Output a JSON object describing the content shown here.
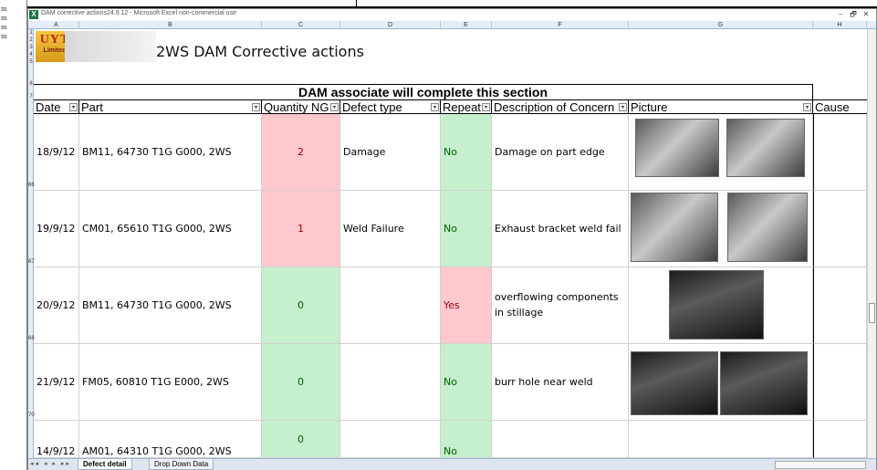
{
  "window": {
    "title": "DAM corrective actions24.9.12 - Microsoft Excel non-commercial use",
    "controls": [
      "–",
      "🗗",
      "✕"
    ]
  },
  "column_letters": [
    "A",
    "B",
    "C",
    "D",
    "E",
    "F",
    "G",
    "H"
  ],
  "row_numbers": [
    "1",
    "2",
    "3",
    "4",
    "5",
    "6",
    "7",
    "66",
    "67",
    "68",
    "70"
  ],
  "logo": {
    "text": "UYT",
    "sub": "Limited"
  },
  "sheet_title": "2WS DAM Corrective actions",
  "section_header": "DAM associate will complete this section",
  "table": {
    "headers": [
      "Date",
      "Part",
      "Quantity NG",
      "Defect type",
      "Repeat",
      "Description of Concern",
      "Picture",
      "Cause"
    ],
    "rows": [
      {
        "date": "18/9/12",
        "part": "BM11, 64730 T1G G000, 2WS",
        "qty": "2",
        "defect": "Damage",
        "repeat": "No",
        "description": "Damage on part edge"
      },
      {
        "date": "19/9/12",
        "part": "CM01, 65610 T1G G000, 2WS",
        "qty": "1",
        "defect": "Weld Failure",
        "repeat": "No",
        "description": "Exhaust bracket weld fail"
      },
      {
        "date": "20/9/12",
        "part": "BM11, 64730 T1G G000, 2WS",
        "qty": "0",
        "defect": "",
        "repeat": "Yes",
        "description": "overflowing components in stillage"
      },
      {
        "date": "21/9/12",
        "part": "FM05, 60810 T1G E000, 2WS",
        "qty": "0",
        "defect": "",
        "repeat": "No",
        "description": "burr hole near weld"
      },
      {
        "date": "14/9/12",
        "part": "AM01, 64310 T1G G000, 2WS",
        "qty": "0",
        "defect": "",
        "repeat": "No",
        "description": ""
      }
    ]
  },
  "sheet_tabs": {
    "nav": "◂◂ ◂ ▸ ▸▸",
    "active": "Defect detail",
    "other": "Drop Down Data"
  },
  "colors": {
    "pink": "#ffc7ce",
    "green": "#c6efce",
    "red_text": "#9c0006",
    "green_text": "#006100"
  }
}
